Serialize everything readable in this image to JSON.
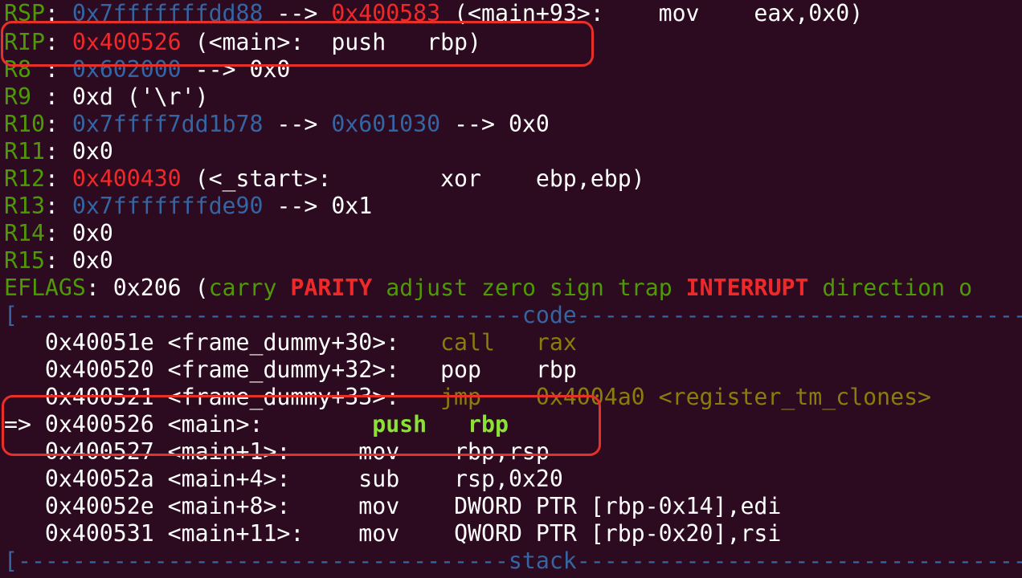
{
  "registers": {
    "rsp": {
      "label": "RSP",
      "sep": ": ",
      "addr": "0x7fffffffdd88",
      "arrow": " --> ",
      "target": "0x400583",
      "rest": " (<main+93>:    mov    eax,0x0)"
    },
    "rip": {
      "label": "RIP",
      "sep": ": ",
      "addr": "0x400526",
      "rest": " (<main>:  push   rbp)"
    },
    "r8": {
      "label": "R8 ",
      "sep": ": ",
      "addr": "0x602000",
      "rest": " --> 0x0"
    },
    "r9": {
      "label": "R9 ",
      "sep": ": ",
      "rest": "0xd ('\\r')"
    },
    "r10": {
      "label": "R10",
      "sep": ": ",
      "addr": "0x7ffff7dd1b78",
      "arrow": " --> ",
      "target": "0x601030",
      "rest": " --> 0x0"
    },
    "r11": {
      "label": "R11",
      "sep": ": ",
      "rest": "0x0"
    },
    "r12": {
      "label": "R12",
      "sep": ": ",
      "addr": "0x400430",
      "rest": " (<_start>:        xor    ebp,ebp)"
    },
    "r13": {
      "label": "R13",
      "sep": ": ",
      "addr": "0x7fffffffde90",
      "rest": " --> 0x1"
    },
    "r14": {
      "label": "R14",
      "sep": ": ",
      "rest": "0x0"
    },
    "r15": {
      "label": "R15",
      "sep": ": ",
      "rest": "0x0"
    },
    "eflags": {
      "label": "EFLAGS",
      "sep": ": ",
      "value": "0x206 (",
      "flags": [
        {
          "text": "carry",
          "set": false
        },
        {
          "text": "PARITY",
          "set": true
        },
        {
          "text": "adjust",
          "set": false
        },
        {
          "text": "zero",
          "set": false
        },
        {
          "text": "sign",
          "set": false
        },
        {
          "text": "trap",
          "set": false
        },
        {
          "text": "INTERRUPT",
          "set": true
        },
        {
          "text": "direction",
          "set": false
        },
        {
          "text": "o",
          "set": false
        }
      ]
    }
  },
  "code_separator": {
    "left": "[-------------------------------------",
    "title": "code",
    "right": "-----------------------------------------"
  },
  "code": [
    {
      "marker": "   ",
      "addr": "0x40051e",
      "sym": " <frame_dummy+30>:   ",
      "op": "call",
      "pad": "   ",
      "args": "rax",
      "style": "past"
    },
    {
      "marker": "   ",
      "addr": "0x400520",
      "sym": " <frame_dummy+32>:   ",
      "op": "pop",
      "pad": "    ",
      "args": "rbp",
      "style": "plain"
    },
    {
      "marker": "   ",
      "addr": "0x400521",
      "sym": " <frame_dummy+33>:   ",
      "op": "jmp",
      "pad": "    ",
      "args": "0x4004a0 <register_tm_clones>",
      "style": "past"
    },
    {
      "marker": "=> ",
      "addr": "0x400526",
      "sym": " <main>:        ",
      "op": "push",
      "pad": "   ",
      "args": "rbp",
      "style": "current"
    },
    {
      "marker": "   ",
      "addr": "0x400527",
      "sym": " <main+1>:     ",
      "op": "mov",
      "pad": "    ",
      "args": "rbp,rsp",
      "style": "plain"
    },
    {
      "marker": "   ",
      "addr": "0x40052a",
      "sym": " <main+4>:     ",
      "op": "sub",
      "pad": "    ",
      "args": "rsp,0x20",
      "style": "plain"
    },
    {
      "marker": "   ",
      "addr": "0x40052e",
      "sym": " <main+8>:     ",
      "op": "mov",
      "pad": "    ",
      "args": "DWORD PTR [rbp-0x14],edi",
      "style": "plain"
    },
    {
      "marker": "   ",
      "addr": "0x400531",
      "sym": " <main+11>:    ",
      "op": "mov",
      "pad": "    ",
      "args": "QWORD PTR [rbp-0x20],rsi",
      "style": "plain"
    }
  ],
  "stack_separator": {
    "left": "[------------------------------------",
    "title": "stack",
    "right": "-----------------------------------------"
  },
  "colors": {
    "background": "#2c0a1f",
    "register_label": "#4e9a06",
    "code_address": "#ef2929",
    "stack_address": "#3465a4",
    "flag_clear": "#4e9a06",
    "flag_set": "#ef2929",
    "current_instruction": "#8ae234",
    "past_instruction": "#8a7d0b",
    "annotation_box": "#e8302a"
  }
}
